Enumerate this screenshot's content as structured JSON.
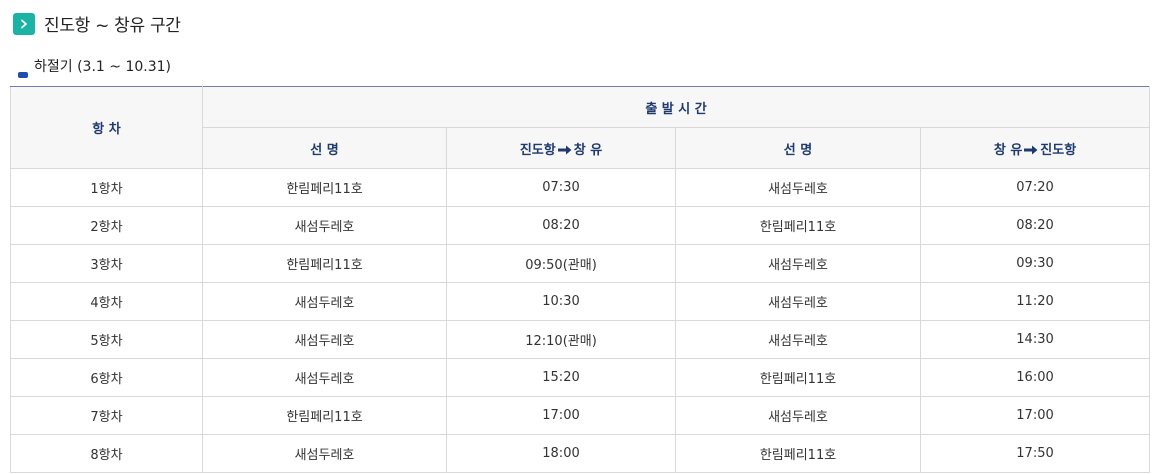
{
  "title": "진도항 ~ 창유 구간",
  "season": "하절기 (3.1 ~ 10.31)",
  "colors": {
    "accent": "#1ab3a6",
    "header_text": "#1e3a6e",
    "bullet": "#1f4fa8"
  },
  "table": {
    "col_voyage": "항 차",
    "col_departure_group": "출 발 시 간",
    "col_ship_1": "선 명",
    "col_route_1_from": "진도항",
    "col_route_1_to": "창 유",
    "col_ship_2": "선 명",
    "col_route_2_from": "창 유",
    "col_route_2_to": "진도항",
    "rows": [
      [
        "1항차",
        "한림페리11호",
        "07:30",
        "새섬두레호",
        "07:20"
      ],
      [
        "2항차",
        "새섬두레호",
        "08:20",
        "한림페리11호",
        "08:20"
      ],
      [
        "3항차",
        "한림페리11호",
        "09:50(관매)",
        "새섬두레호",
        "09:30"
      ],
      [
        "4항차",
        "새섬두레호",
        "10:30",
        "새섬두레호",
        "11:20"
      ],
      [
        "5항차",
        "새섬두레호",
        "12:10(관매)",
        "새섬두레호",
        "14:30"
      ],
      [
        "6항차",
        "새섬두레호",
        "15:20",
        "한림페리11호",
        "16:00"
      ],
      [
        "7항차",
        "한림페리11호",
        "17:00",
        "새섬두레호",
        "17:00"
      ],
      [
        "8항차",
        "새섬두레호",
        "18:00",
        "한림페리11호",
        "17:50"
      ]
    ]
  }
}
